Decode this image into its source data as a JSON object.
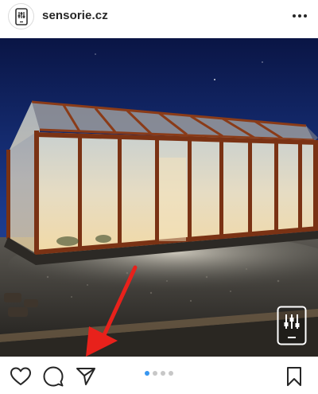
{
  "header": {
    "username": "sensorie.cz",
    "avatar_icon": "sensor-tablet-icon",
    "more_icon": "more-horizontal-icon"
  },
  "post": {
    "scene": "greenhouse-at-night",
    "overlay_icon": "sensor-tablet-icon",
    "annotation": "red-arrow-pointing-to-share"
  },
  "actions": {
    "like_icon": "heart-icon",
    "comment_icon": "comment-icon",
    "share_icon": "paper-plane-icon",
    "save_icon": "bookmark-icon"
  },
  "carousel": {
    "count": 4,
    "active_index": 0
  },
  "colors": {
    "accent": "#3897f0",
    "arrow": "#e8211b",
    "text": "#262626"
  }
}
